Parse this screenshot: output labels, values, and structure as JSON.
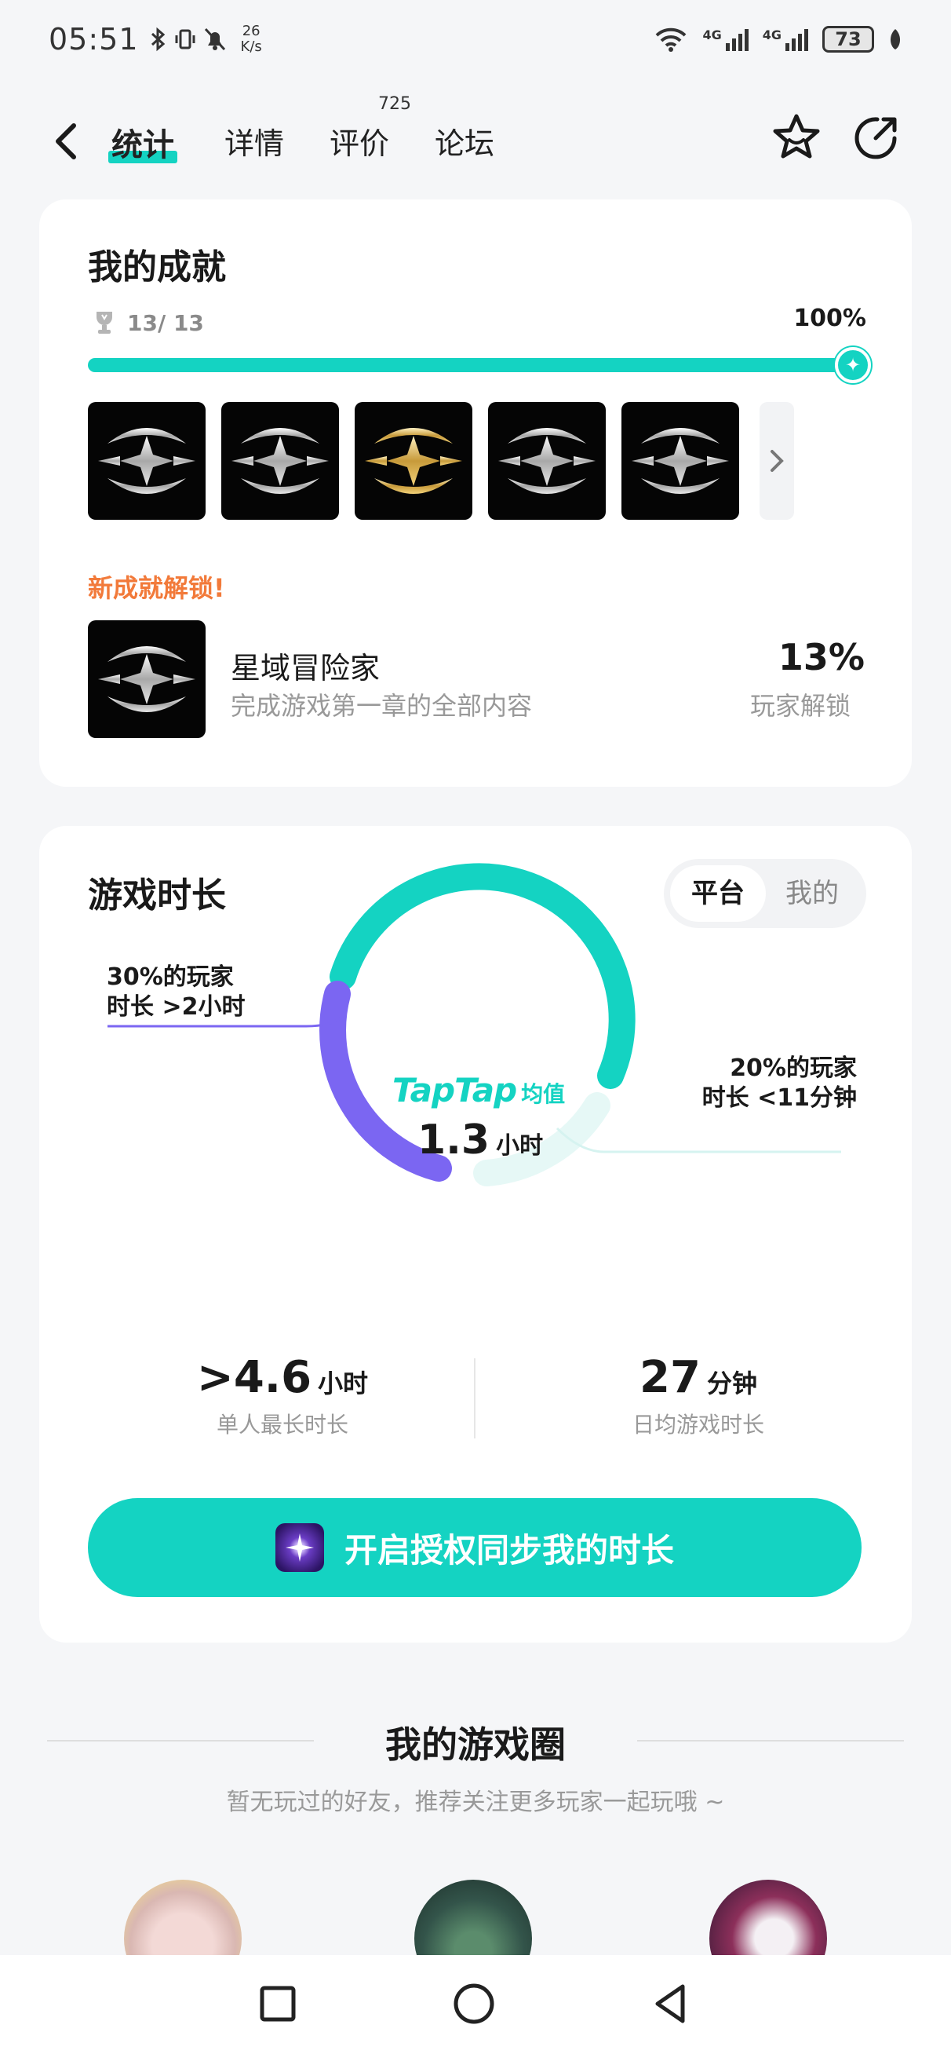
{
  "status_bar": {
    "time": "05:51",
    "net_speed_value": "26",
    "net_speed_unit": "K/s",
    "signal1_label": "4G",
    "signal2_label": "4G",
    "battery": "73"
  },
  "nav": {
    "tabs": [
      {
        "label": "统计",
        "active": true
      },
      {
        "label": "详情",
        "active": false
      },
      {
        "label": "评价",
        "active": false
      },
      {
        "label": "论坛",
        "active": false
      }
    ],
    "review_count": "725"
  },
  "achievements": {
    "title": "我的成就",
    "count": "13/ 13",
    "percent": "100%",
    "progress": 1.0,
    "new_unlock_label": "新成就解锁!",
    "latest": {
      "name": "星域冒险家",
      "desc": "完成游戏第一章的全部内容",
      "percent": "13%",
      "percent_label": "玩家解锁"
    }
  },
  "playtime": {
    "title": "游戏时长",
    "toggle": {
      "platform": "平台",
      "mine": "我的"
    },
    "donut": {
      "brand": "TapTap",
      "brand_suffix": "均值",
      "value": "1.3",
      "unit": "小时"
    },
    "callout_left_line1": "30%的玩家",
    "callout_left_line2": "时长 >2小时",
    "callout_right_line1": "20%的玩家",
    "callout_right_line2": "时长 <11分钟",
    "stat1": {
      "value": ">4.6",
      "unit": "小时",
      "label": "单人最长时长"
    },
    "stat2": {
      "value": "27",
      "unit": "分钟",
      "label": "日均游戏时长"
    },
    "cta_label": "开启授权同步我的时长",
    "colors": {
      "accent": "#14d3c2",
      "purple": "#7b66f2",
      "light": "#e6f8f6"
    }
  },
  "circle": {
    "title": "我的游戏圈",
    "subtitle": "暂无玩过的好友，推荐关注更多玩家一起玩哦 ~"
  }
}
